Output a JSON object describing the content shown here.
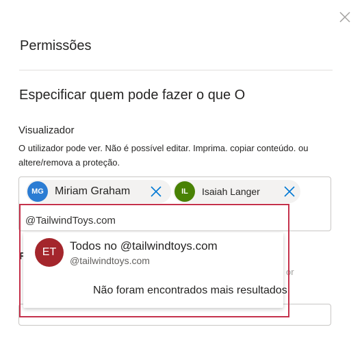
{
  "dialog": {
    "title": "Permissões",
    "heading": "Especificar quem pode fazer o que O"
  },
  "role": {
    "label": "Visualizador",
    "description": "O utilizador pode ver. Não é possível editar. Imprima. copiar conteúdo. ou altere/remova a proteção."
  },
  "people": [
    {
      "initials": "MG",
      "name": "Miriam Graham",
      "color": "#2b7cd3"
    },
    {
      "initials": "IL",
      "name": "Isaiah Langer",
      "color": "#498205"
    }
  ],
  "search": {
    "value": "@TailwindToys.com"
  },
  "suggestion": {
    "initials": "ET",
    "name": "Todos no @tailwindtoys.com",
    "sub": "@tailwindtoys.com",
    "color": "#a4262c"
  },
  "no_more_results": "Não foram encontrados mais resultados.",
  "background_peek": {
    "letter": "R",
    "or_text": "or"
  },
  "colors": {
    "highlight": "#c4314b",
    "accent": "#0078d4"
  }
}
